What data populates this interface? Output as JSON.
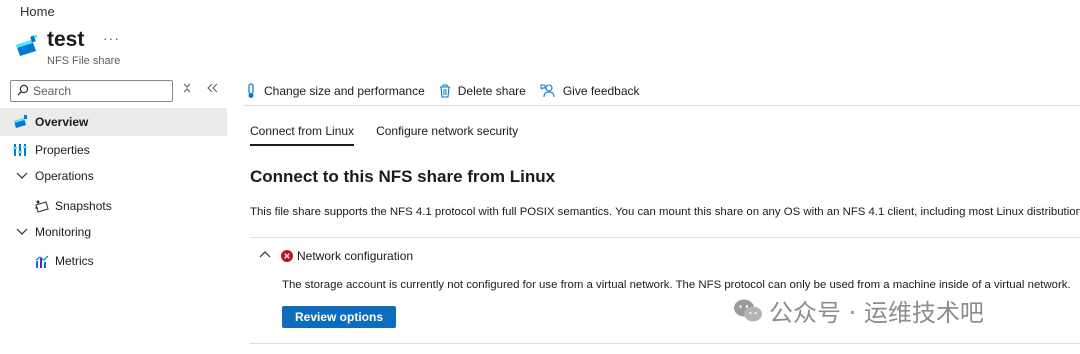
{
  "breadcrumb": {
    "home": "Home"
  },
  "resource": {
    "name": "test",
    "type": "NFS File share",
    "more": "···"
  },
  "sidebar": {
    "search_placeholder": "Search",
    "items": [
      {
        "label": "Overview",
        "icon": "file-share-icon",
        "active": true
      },
      {
        "label": "Properties",
        "icon": "properties-icon"
      },
      {
        "label": "Operations",
        "icon": "chevron-down-icon",
        "group": true
      },
      {
        "label": "Snapshots",
        "icon": "snapshots-icon"
      },
      {
        "label": "Monitoring",
        "icon": "chevron-down-icon",
        "group": true
      },
      {
        "label": "Metrics",
        "icon": "metrics-icon"
      }
    ]
  },
  "toolbar": {
    "change_size": "Change size and performance",
    "delete_share": "Delete share",
    "give_feedback": "Give feedback"
  },
  "tabs": [
    {
      "label": "Connect from Linux",
      "active": true
    },
    {
      "label": "Configure network security"
    }
  ],
  "main": {
    "title": "Connect to this NFS share from Linux",
    "description": "This file share supports the NFS 4.1 protocol with full POSIX semantics. You can mount this share on any OS with an NFS 4.1 client, including most Linux distributions.",
    "network": {
      "title": "Network configuration",
      "status": "error",
      "message": "The storage account is currently not configured for use from a virtual network. The NFS protocol can only be used from a machine inside of a virtual network.",
      "button": "Review options"
    }
  },
  "watermark": {
    "text": "公众号 · 运维技术吧"
  },
  "colors": {
    "accent": "#0f6cbd",
    "error": "#c50f1f",
    "icon_blue": "#0078d4",
    "active_bg": "#edebe9"
  }
}
